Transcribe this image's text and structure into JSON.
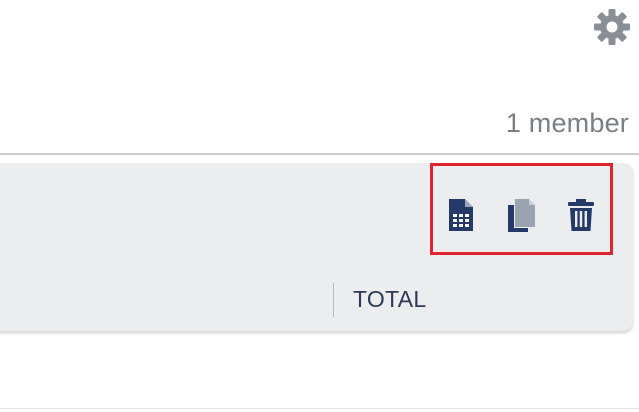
{
  "header": {
    "settings_icon": "gear-icon",
    "member_count": "1 member"
  },
  "card": {
    "actions": [
      {
        "icon": "spreadsheet-document-icon"
      },
      {
        "icon": "copy-document-icon"
      },
      {
        "icon": "trash-icon"
      }
    ],
    "column_header": "TOTAL"
  },
  "colors": {
    "icon_navy": "#243a6b",
    "gear_gray": "#8a8f96",
    "card_bg": "#ecedef",
    "highlight_red": "#e0242f",
    "text_navy": "#2c3957",
    "muted_text": "#7a7f86"
  }
}
